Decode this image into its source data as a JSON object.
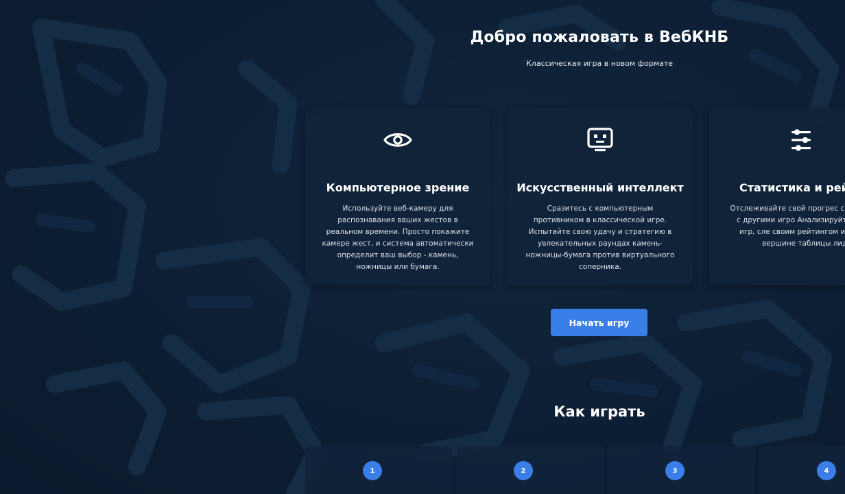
{
  "hero": {
    "title": "Добро пожаловать в ВебКНБ",
    "subtitle": "Классическая игра в новом формате"
  },
  "features": [
    {
      "icon": "eye-icon",
      "title": "Компьютерное зрение",
      "text": "Используйте веб-камеру для распознавания ваших жестов в реальном времени. Просто покажите камере жест, и система автоматически определит ваш выбор - камень, ножницы или бумага."
    },
    {
      "icon": "robot-icon",
      "title": "Искусственный интеллект",
      "text": "Сразитесь с компьютерным противником в классической игре. Испытайте свою удачу и стратегию в увлекательных раундах камень-ножницы-бумага против виртуального соперника."
    },
    {
      "icon": "sliders-icon",
      "title": "Статистика и рейт",
      "text": "Отслеживайте свой прогрес соревнуйтесь с другими игро Анализируйте историю игр, сле своим рейтингом и стремите вершине таблицы лидеро"
    }
  ],
  "cta": {
    "start_label": "Начать игру"
  },
  "how_to_play": {
    "title": "Как играть",
    "steps": [
      "1",
      "2",
      "3",
      "4"
    ]
  },
  "colors": {
    "background": "#0d2036",
    "card": "#10243a",
    "accent": "#3a7ee8",
    "text": "#ffffff"
  }
}
